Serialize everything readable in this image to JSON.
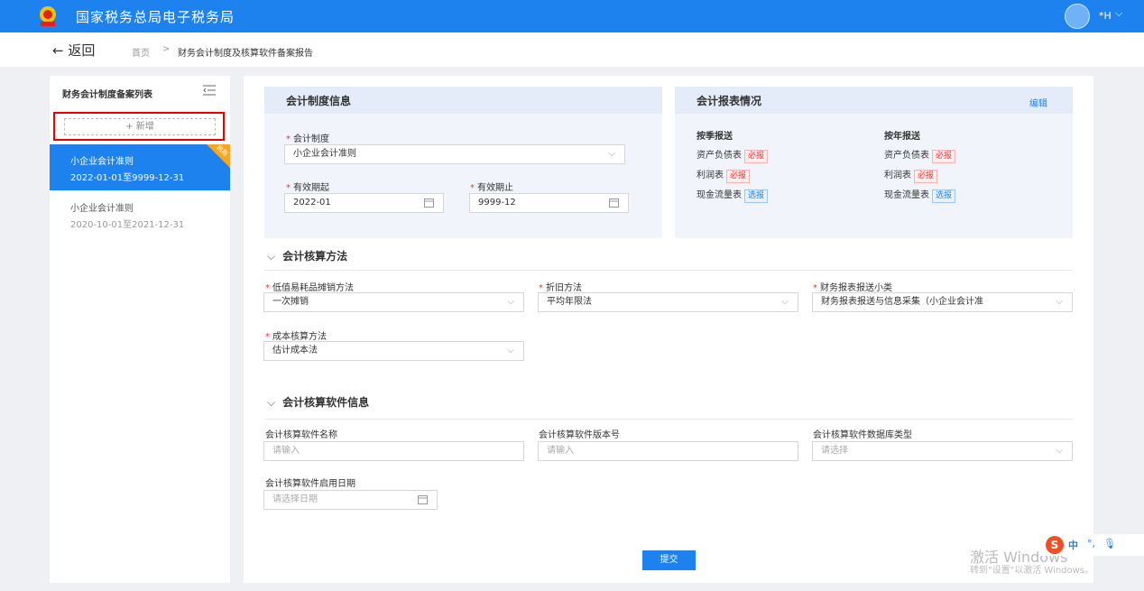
{
  "header": {
    "app_title": "国家税务总局电子税务局",
    "user_name": "*H",
    "user_chevron": "⌵"
  },
  "nav": {
    "back_label": "← 返回",
    "breadcrumb": [
      "首页",
      "财务会计制度及核算软件备案报告"
    ],
    "separator": ">"
  },
  "sidebar": {
    "title": "财务会计制度备案列表",
    "add_label": "+ 新增",
    "items": [
      {
        "name": "小企业会计准则",
        "range": "2022-01-01至9999-12-31",
        "badge": "启用",
        "active": true
      },
      {
        "name": "小企业会计准则",
        "range": "2020-10-01至2021-12-31",
        "active": false
      }
    ]
  },
  "accounting_system": {
    "title": "会计制度信息",
    "system_label": "会计制度",
    "system_value": "小企业会计准则",
    "start_label": "有效期起",
    "start_value": "2022-01",
    "end_label": "有效期止",
    "end_value": "9999-12"
  },
  "report_status": {
    "title": "会计报表情况",
    "edit_label": "编辑",
    "quarterly": {
      "title": "按季报送",
      "items": [
        {
          "name": "资产负债表",
          "tag": "必报",
          "kind": "must"
        },
        {
          "name": "利润表",
          "tag": "必报",
          "kind": "must"
        },
        {
          "name": "现金流量表",
          "tag": "选报",
          "kind": "opt"
        }
      ]
    },
    "annual": {
      "title": "按年报送",
      "items": [
        {
          "name": "资产负债表",
          "tag": "必报",
          "kind": "must"
        },
        {
          "name": "利润表",
          "tag": "必报",
          "kind": "must"
        },
        {
          "name": "现金流量表",
          "tag": "选报",
          "kind": "opt"
        }
      ]
    }
  },
  "methods": {
    "title": "会计核算方法",
    "low_value_label": "低值易耗品摊销方法",
    "low_value_value": "一次摊销",
    "depreciation_label": "折旧方法",
    "depreciation_value": "平均年限法",
    "report_subclass_label": "财务报表报送小类",
    "report_subclass_value": "财务报表报送与信息采集（小企业会计准",
    "cost_label": "成本核算方法",
    "cost_value": "估计成本法"
  },
  "software": {
    "title": "会计核算软件信息",
    "name_label": "会计核算软件名称",
    "name_placeholder": "请输入",
    "version_label": "会计核算软件版本号",
    "version_placeholder": "请输入",
    "db_label": "会计核算软件数据库类型",
    "db_placeholder": "请选择",
    "date_label": "会计核算软件启用日期",
    "date_placeholder": "请选择日期"
  },
  "submit_label": "提交",
  "watermark": {
    "line1": "激活 Windows",
    "line2": "转到\"设置\"以激活 Windows。"
  },
  "ime": {
    "logo": "S",
    "lang": "中",
    "punct": "°,",
    "mic": "🎙"
  },
  "colors": {
    "primary": "#1e82ee",
    "required": "#e33",
    "badge": "#f5a623"
  }
}
